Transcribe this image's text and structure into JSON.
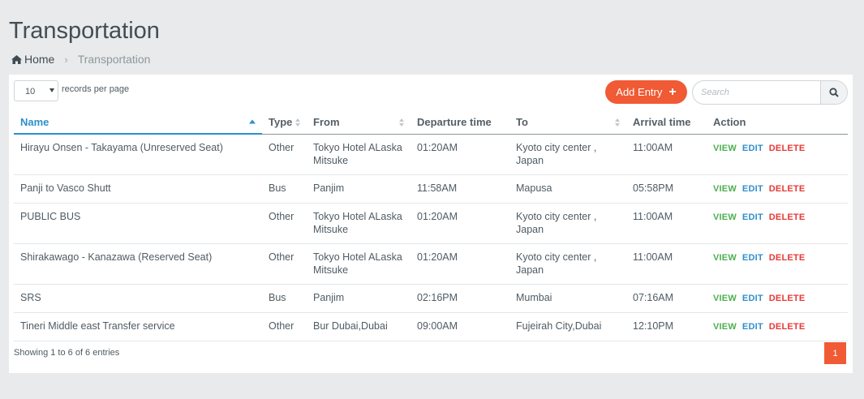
{
  "page": {
    "title": "Transportation"
  },
  "breadcrumb": {
    "home": "Home",
    "current": "Transportation"
  },
  "controls": {
    "page_length": "10",
    "page_length_label": "records per page",
    "add_entry_label": "Add Entry",
    "search_placeholder": "Search"
  },
  "table": {
    "headers": {
      "name": "Name",
      "type": "Type",
      "from": "From",
      "departure": "Departure time",
      "to": "To",
      "arrival": "Arrival time",
      "action": "Action"
    },
    "actions": {
      "view": "VIEW",
      "edit": "EDIT",
      "delete": "DELETE"
    },
    "rows": [
      {
        "name": "Hirayu Onsen - Takayama (Unreserved Seat)",
        "type": "Other",
        "from": "Tokyo Hotel ALaska Mitsuke",
        "departure": "01:20AM",
        "to": "Kyoto city center , Japan",
        "arrival": "11:00AM"
      },
      {
        "name": "Panji to Vasco Shutt",
        "type": "Bus",
        "from": "Panjim",
        "departure": "11:58AM",
        "to": "Mapusa",
        "arrival": "05:58PM"
      },
      {
        "name": "PUBLIC BUS",
        "type": "Other",
        "from": "Tokyo Hotel ALaska Mitsuke",
        "departure": "01:20AM",
        "to": "Kyoto city center , Japan",
        "arrival": "11:00AM"
      },
      {
        "name": "Shirakawago - Kanazawa (Reserved Seat)",
        "type": "Other",
        "from": "Tokyo Hotel ALaska Mitsuke",
        "departure": "01:20AM",
        "to": "Kyoto city center , Japan",
        "arrival": "11:00AM"
      },
      {
        "name": "SRS",
        "type": "Bus",
        "from": "Panjim",
        "departure": "02:16PM",
        "to": "Mumbai",
        "arrival": "07:16AM"
      },
      {
        "name": "Tineri Middle east Transfer service",
        "type": "Other",
        "from": "Bur Dubai,Dubai",
        "departure": "09:00AM",
        "to": "Fujeirah City,Dubai",
        "arrival": "12:10PM"
      }
    ]
  },
  "footer": {
    "info": "Showing 1 to 6 of 6 entries",
    "current_page": "1"
  },
  "colors": {
    "accent": "#f05a34",
    "link_blue": "#2c90c9",
    "view_green": "#4caf50",
    "delete_red": "#e53935"
  }
}
